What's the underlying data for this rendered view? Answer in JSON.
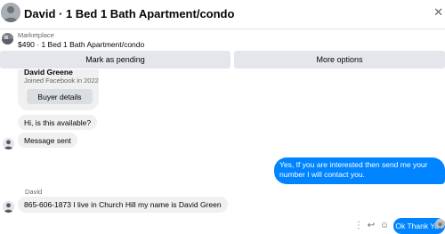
{
  "header": {
    "title": "David · 1 Bed 1 Bath Apartment/condo",
    "close_icon": "close-icon"
  },
  "listing": {
    "source": "Marketplace",
    "price_title": "$490 · 1 Bed 1 Bath Apartment/condo"
  },
  "actions": {
    "mark_pending": "Mark as pending",
    "more_options": "More options"
  },
  "buyer_card": {
    "name": "David Greene",
    "joined": "Joined Facebook in 2022",
    "details_button": "Buyer details"
  },
  "messages": {
    "incoming_1": "Hi, is this available?",
    "incoming_2": "Message sent",
    "outgoing_1": "Yes, If you are interested then send me your number I will contact you.",
    "sender_name": "David",
    "incoming_3": "865-606-1873 I live in Church Hill my name is David Green",
    "outgoing_2": "Ok Thank You"
  },
  "message_actions": {
    "more": "⋮",
    "reply": "↩",
    "react": "☺"
  },
  "colors": {
    "accent": "#0084ff",
    "bubble_gray": "#f0f0f0",
    "button_gray": "#e4e6eb"
  }
}
